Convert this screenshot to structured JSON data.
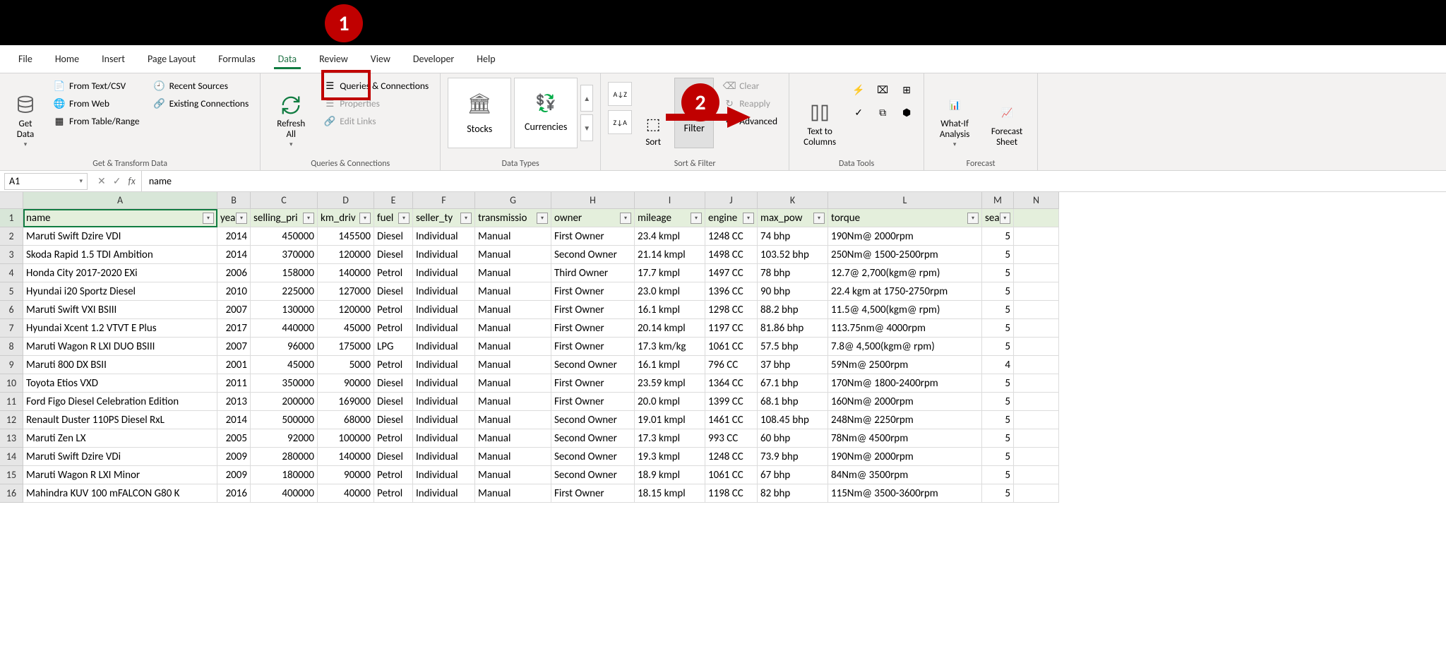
{
  "tabs": [
    "File",
    "Home",
    "Insert",
    "Page Layout",
    "Formulas",
    "Data",
    "Review",
    "View",
    "Developer",
    "Help"
  ],
  "active_tab": "Data",
  "ribbon": {
    "get_data": "Get\nData",
    "from_text": "From Text/CSV",
    "from_web": "From Web",
    "from_table": "From Table/Range",
    "recent": "Recent Sources",
    "existing": "Existing Connections",
    "g1_label": "Get & Transform Data",
    "refresh": "Refresh\nAll",
    "queries": "Queries & Connections",
    "properties": "Properties",
    "edit_links": "Edit Links",
    "g2_label": "Queries & Connections",
    "stocks": "Stocks",
    "currencies": "Currencies",
    "g3_label": "Data Types",
    "sort_big": "Sort",
    "filter": "Filter",
    "clear": "Clear",
    "reapply": "Reapply",
    "advanced": "Advanced",
    "g4_label": "Sort & Filter",
    "text_cols": "Text to\nColumns",
    "g5_label": "Data Tools",
    "whatif": "What-If\nAnalysis",
    "forecast": "Forecast\nSheet",
    "g6_label": "Forecast"
  },
  "name_box": "A1",
  "formula": "name",
  "columns": [
    "A",
    "B",
    "C",
    "D",
    "E",
    "F",
    "G",
    "H",
    "I",
    "J",
    "K",
    "L",
    "M",
    "N"
  ],
  "headers": [
    "name",
    "yea",
    "selling_pri",
    "km_driv",
    "fuel",
    "seller_ty",
    "transmissio",
    "owner",
    "mileage",
    "engine",
    "max_pow",
    "torque",
    "sea",
    ""
  ],
  "chart_data": {
    "type": "table",
    "columns": [
      "name",
      "year",
      "selling_price",
      "km_driven",
      "fuel",
      "seller_type",
      "transmission",
      "owner",
      "mileage",
      "engine",
      "max_power",
      "torque",
      "seats"
    ],
    "rows": [
      [
        "Maruti Swift Dzire VDI",
        "2014",
        "450000",
        "145500",
        "Diesel",
        "Individual",
        "Manual",
        "First Owner",
        "23.4 kmpl",
        "1248 CC",
        "74 bhp",
        "190Nm@ 2000rpm",
        "5"
      ],
      [
        "Skoda Rapid 1.5 TDI Ambition",
        "2014",
        "370000",
        "120000",
        "Diesel",
        "Individual",
        "Manual",
        "Second Owner",
        "21.14 kmpl",
        "1498 CC",
        "103.52 bhp",
        "250Nm@ 1500-2500rpm",
        "5"
      ],
      [
        "Honda City 2017-2020 EXi",
        "2006",
        "158000",
        "140000",
        "Petrol",
        "Individual",
        "Manual",
        "Third Owner",
        "17.7 kmpl",
        "1497 CC",
        "78 bhp",
        "12.7@ 2,700(kgm@ rpm)",
        "5"
      ],
      [
        "Hyundai i20 Sportz Diesel",
        "2010",
        "225000",
        "127000",
        "Diesel",
        "Individual",
        "Manual",
        "First Owner",
        "23.0 kmpl",
        "1396 CC",
        "90 bhp",
        "22.4 kgm at 1750-2750rpm",
        "5"
      ],
      [
        "Maruti Swift VXI BSIII",
        "2007",
        "130000",
        "120000",
        "Petrol",
        "Individual",
        "Manual",
        "First Owner",
        "16.1 kmpl",
        "1298 CC",
        "88.2 bhp",
        "11.5@ 4,500(kgm@ rpm)",
        "5"
      ],
      [
        "Hyundai Xcent 1.2 VTVT E Plus",
        "2017",
        "440000",
        "45000",
        "Petrol",
        "Individual",
        "Manual",
        "First Owner",
        "20.14 kmpl",
        "1197 CC",
        "81.86 bhp",
        "113.75nm@ 4000rpm",
        "5"
      ],
      [
        "Maruti Wagon R LXI DUO BSIII",
        "2007",
        "96000",
        "175000",
        "LPG",
        "Individual",
        "Manual",
        "First Owner",
        "17.3 km/kg",
        "1061 CC",
        "57.5 bhp",
        "7.8@ 4,500(kgm@ rpm)",
        "5"
      ],
      [
        "Maruti 800 DX BSII",
        "2001",
        "45000",
        "5000",
        "Petrol",
        "Individual",
        "Manual",
        "Second Owner",
        "16.1 kmpl",
        "796 CC",
        "37 bhp",
        "59Nm@ 2500rpm",
        "4"
      ],
      [
        "Toyota Etios VXD",
        "2011",
        "350000",
        "90000",
        "Diesel",
        "Individual",
        "Manual",
        "First Owner",
        "23.59 kmpl",
        "1364 CC",
        "67.1 bhp",
        "170Nm@ 1800-2400rpm",
        "5"
      ],
      [
        "Ford Figo Diesel Celebration Edition",
        "2013",
        "200000",
        "169000",
        "Diesel",
        "Individual",
        "Manual",
        "First Owner",
        "20.0 kmpl",
        "1399 CC",
        "68.1 bhp",
        "160Nm@ 2000rpm",
        "5"
      ],
      [
        "Renault Duster 110PS Diesel RxL",
        "2014",
        "500000",
        "68000",
        "Diesel",
        "Individual",
        "Manual",
        "Second Owner",
        "19.01 kmpl",
        "1461 CC",
        "108.45 bhp",
        "248Nm@ 2250rpm",
        "5"
      ],
      [
        "Maruti Zen LX",
        "2005",
        "92000",
        "100000",
        "Petrol",
        "Individual",
        "Manual",
        "Second Owner",
        "17.3 kmpl",
        "993 CC",
        "60 bhp",
        "78Nm@ 4500rpm",
        "5"
      ],
      [
        "Maruti Swift Dzire VDi",
        "2009",
        "280000",
        "140000",
        "Diesel",
        "Individual",
        "Manual",
        "Second Owner",
        "19.3 kmpl",
        "1248 CC",
        "73.9 bhp",
        "190Nm@ 2000rpm",
        "5"
      ],
      [
        "Maruti Wagon R LXI Minor",
        "2009",
        "180000",
        "90000",
        "Petrol",
        "Individual",
        "Manual",
        "Second Owner",
        "18.9 kmpl",
        "1061 CC",
        "67 bhp",
        "84Nm@ 3500rpm",
        "5"
      ],
      [
        "Mahindra KUV 100 mFALCON G80 K",
        "2016",
        "400000",
        "40000",
        "Petrol",
        "Individual",
        "Manual",
        "First Owner",
        "18.15 kmpl",
        "1198 CC",
        "82 bhp",
        "115Nm@ 3500-3600rpm",
        "5"
      ]
    ]
  },
  "annotations": {
    "circle1": "1",
    "circle2": "2"
  }
}
